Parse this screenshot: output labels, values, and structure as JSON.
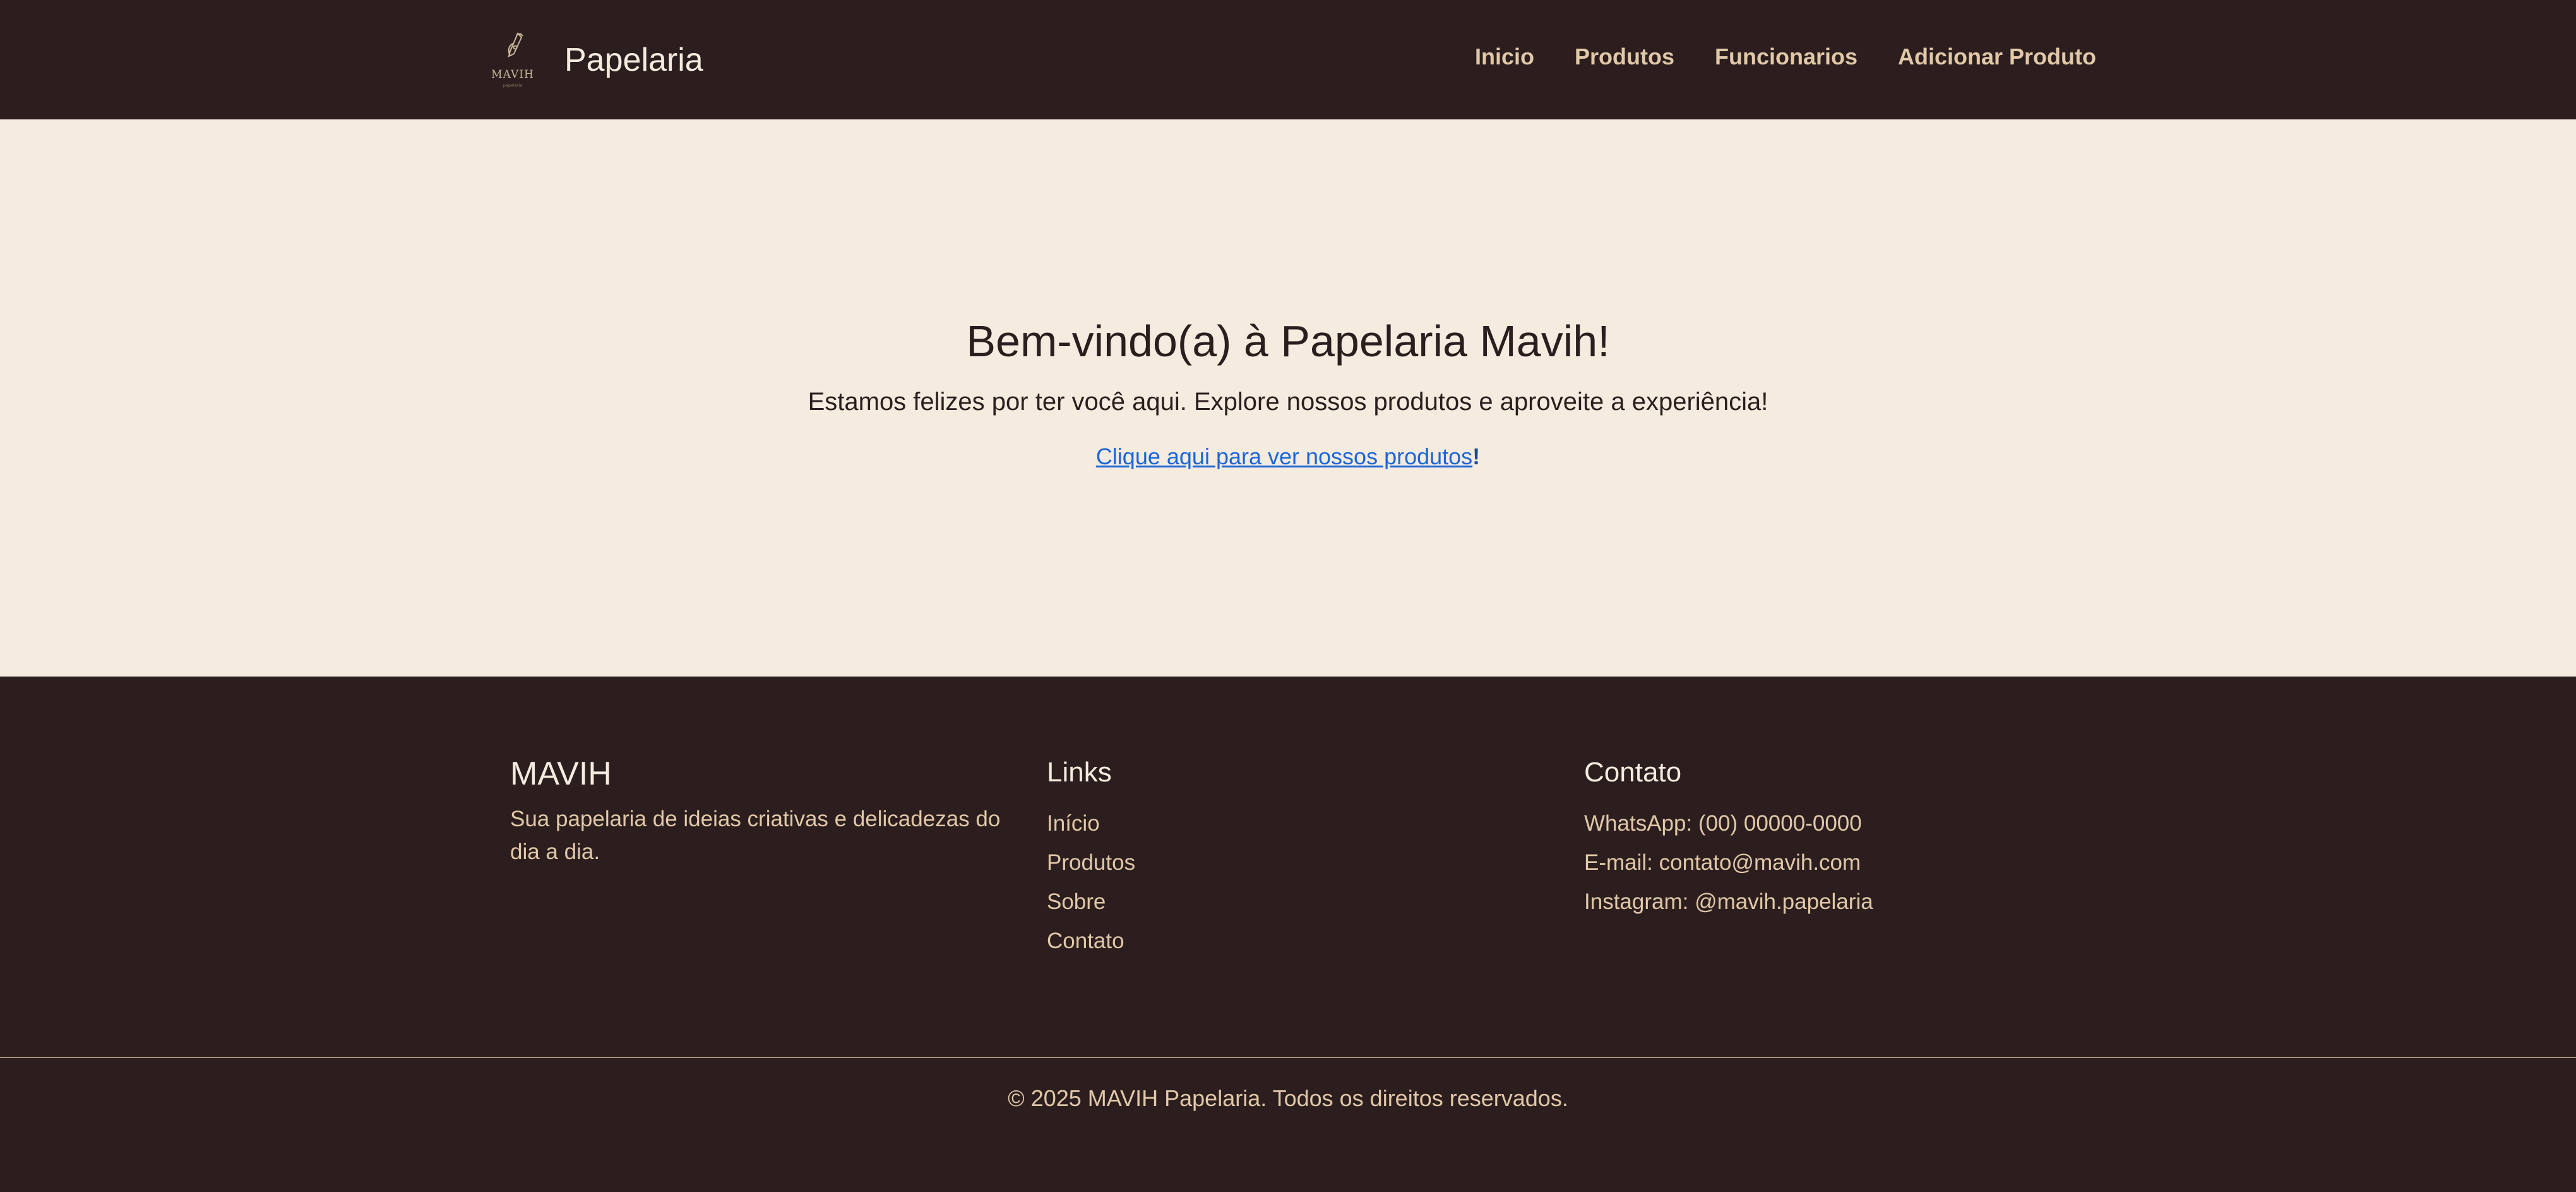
{
  "header": {
    "logo_text": "MAVIH",
    "logo_subtext": "papelaria",
    "brand_name": "Papelaria",
    "nav": [
      {
        "label": "Inicio"
      },
      {
        "label": "Produtos"
      },
      {
        "label": "Funcionarios"
      },
      {
        "label": "Adicionar Produto"
      }
    ]
  },
  "hero": {
    "title": "Bem-vindo(a) à Papelaria Mavih!",
    "subtitle": "Estamos felizes por ter você aqui. Explore nossos produtos e aproveite a experiência!",
    "cta_link": "Clique aqui para ver nossos produtos",
    "cta_suffix": "!"
  },
  "footer": {
    "about": {
      "title": "MAVIH",
      "description": "Sua papelaria de ideias criativas e delicadezas do dia a dia."
    },
    "links": {
      "title": "Links",
      "items": [
        "Início",
        "Produtos",
        "Sobre",
        "Contato"
      ]
    },
    "contact": {
      "title": "Contato",
      "items": [
        "WhatsApp: (00) 00000-0000",
        "E-mail: contato@mavih.com",
        "Instagram: @mavih.papelaria"
      ]
    },
    "copyright": "© 2025 MAVIH Papelaria. Todos os direitos reservados."
  },
  "colors": {
    "dark_brown": "#2c1e1e",
    "cream": "#f5ebdf",
    "tan": "#e0c8a8",
    "link_blue": "#1a66d9"
  }
}
